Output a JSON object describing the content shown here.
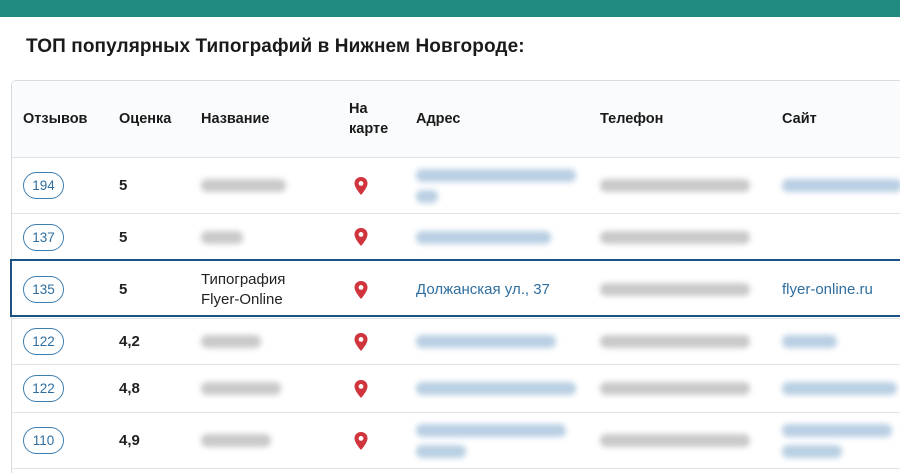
{
  "page": {
    "title": "ТОП популярных Типографий в Нижнем Новгороде:"
  },
  "table": {
    "headers": {
      "reviews": "Отзывов",
      "rating": "Оценка",
      "name": "Название",
      "map_line1": "На",
      "map_line2": "карте",
      "address": "Адрес",
      "phone": "Телефон",
      "site": "Сайт"
    },
    "rows": [
      {
        "reviews": "194",
        "rating": "5",
        "name": "",
        "address": "",
        "phone": "",
        "site": ""
      },
      {
        "reviews": "137",
        "rating": "5",
        "name": "",
        "address": "",
        "phone": "",
        "site": ""
      },
      {
        "reviews": "135",
        "rating": "5",
        "name_line1": "Типография",
        "name_line2": "Flyer-Online",
        "address": "Должанская ул., 37",
        "phone": "",
        "site": "flyer-online.ru"
      },
      {
        "reviews": "122",
        "rating": "4,2",
        "name": "",
        "address": "",
        "phone": "",
        "site": ""
      },
      {
        "reviews": "122",
        "rating": "4,8",
        "name": "",
        "address": "",
        "phone": "",
        "site": ""
      },
      {
        "reviews": "110",
        "rating": "4,9",
        "name": "",
        "address": "",
        "phone": "",
        "site": ""
      }
    ]
  },
  "colors": {
    "topbar": "#1f8a7d",
    "link": "#2f6e9f",
    "map_pin": "#d0343c",
    "highlight_border": "#1a5286"
  },
  "icons": {
    "map_marker": "map-pin-icon"
  }
}
